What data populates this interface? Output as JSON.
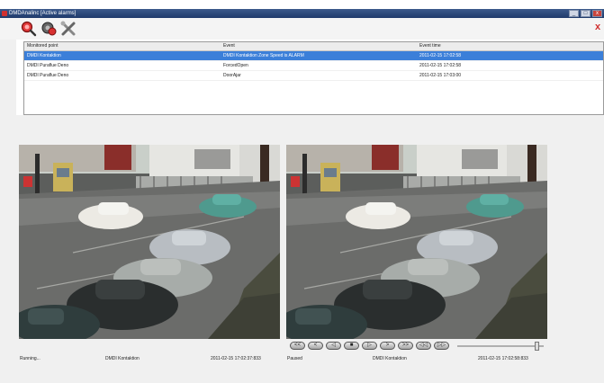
{
  "window": {
    "title": "DMDAnalinc  [Active alarms]",
    "min_label": "_",
    "max_label": "□",
    "close_label": "x"
  },
  "toolbar": {
    "buttons": [
      {
        "icon": "magnifier-alarm-icon"
      },
      {
        "icon": "camera-settings-icon"
      },
      {
        "icon": "tools-icon"
      }
    ],
    "corner_label": "x"
  },
  "alarm_table": {
    "headers": [
      "Monitored point",
      "Event",
      "Event time"
    ],
    "rows": [
      {
        "point": "DMDI Kontaktion",
        "event": "DMDI Kontaktion Zone Speed is ALARM",
        "time": "2011-02-15 17:02:58"
      },
      {
        "point": "DMDI Puraflue Deno",
        "event": "ForcedOpen",
        "time": "2011-02-15 17:02:58"
      },
      {
        "point": "DMDI Puraflue Deno",
        "event": "DoorAjar",
        "time": "2011-02-15 17:03:00"
      }
    ],
    "selected_row": 0
  },
  "live_view": {
    "status": "Running...",
    "camera": "DMDI Kontaktion",
    "timestamp": "2011-02-15 17:02:37:833"
  },
  "playback_view": {
    "status": "Paused",
    "camera": "DMDI Kontaktion",
    "timestamp": "2011-02-15 17:02:58:833",
    "controls": [
      "<<",
      "<",
      "◁",
      "■",
      "▷",
      ">",
      ">>",
      "◁◁",
      "▷▷"
    ],
    "position": 0.92
  }
}
